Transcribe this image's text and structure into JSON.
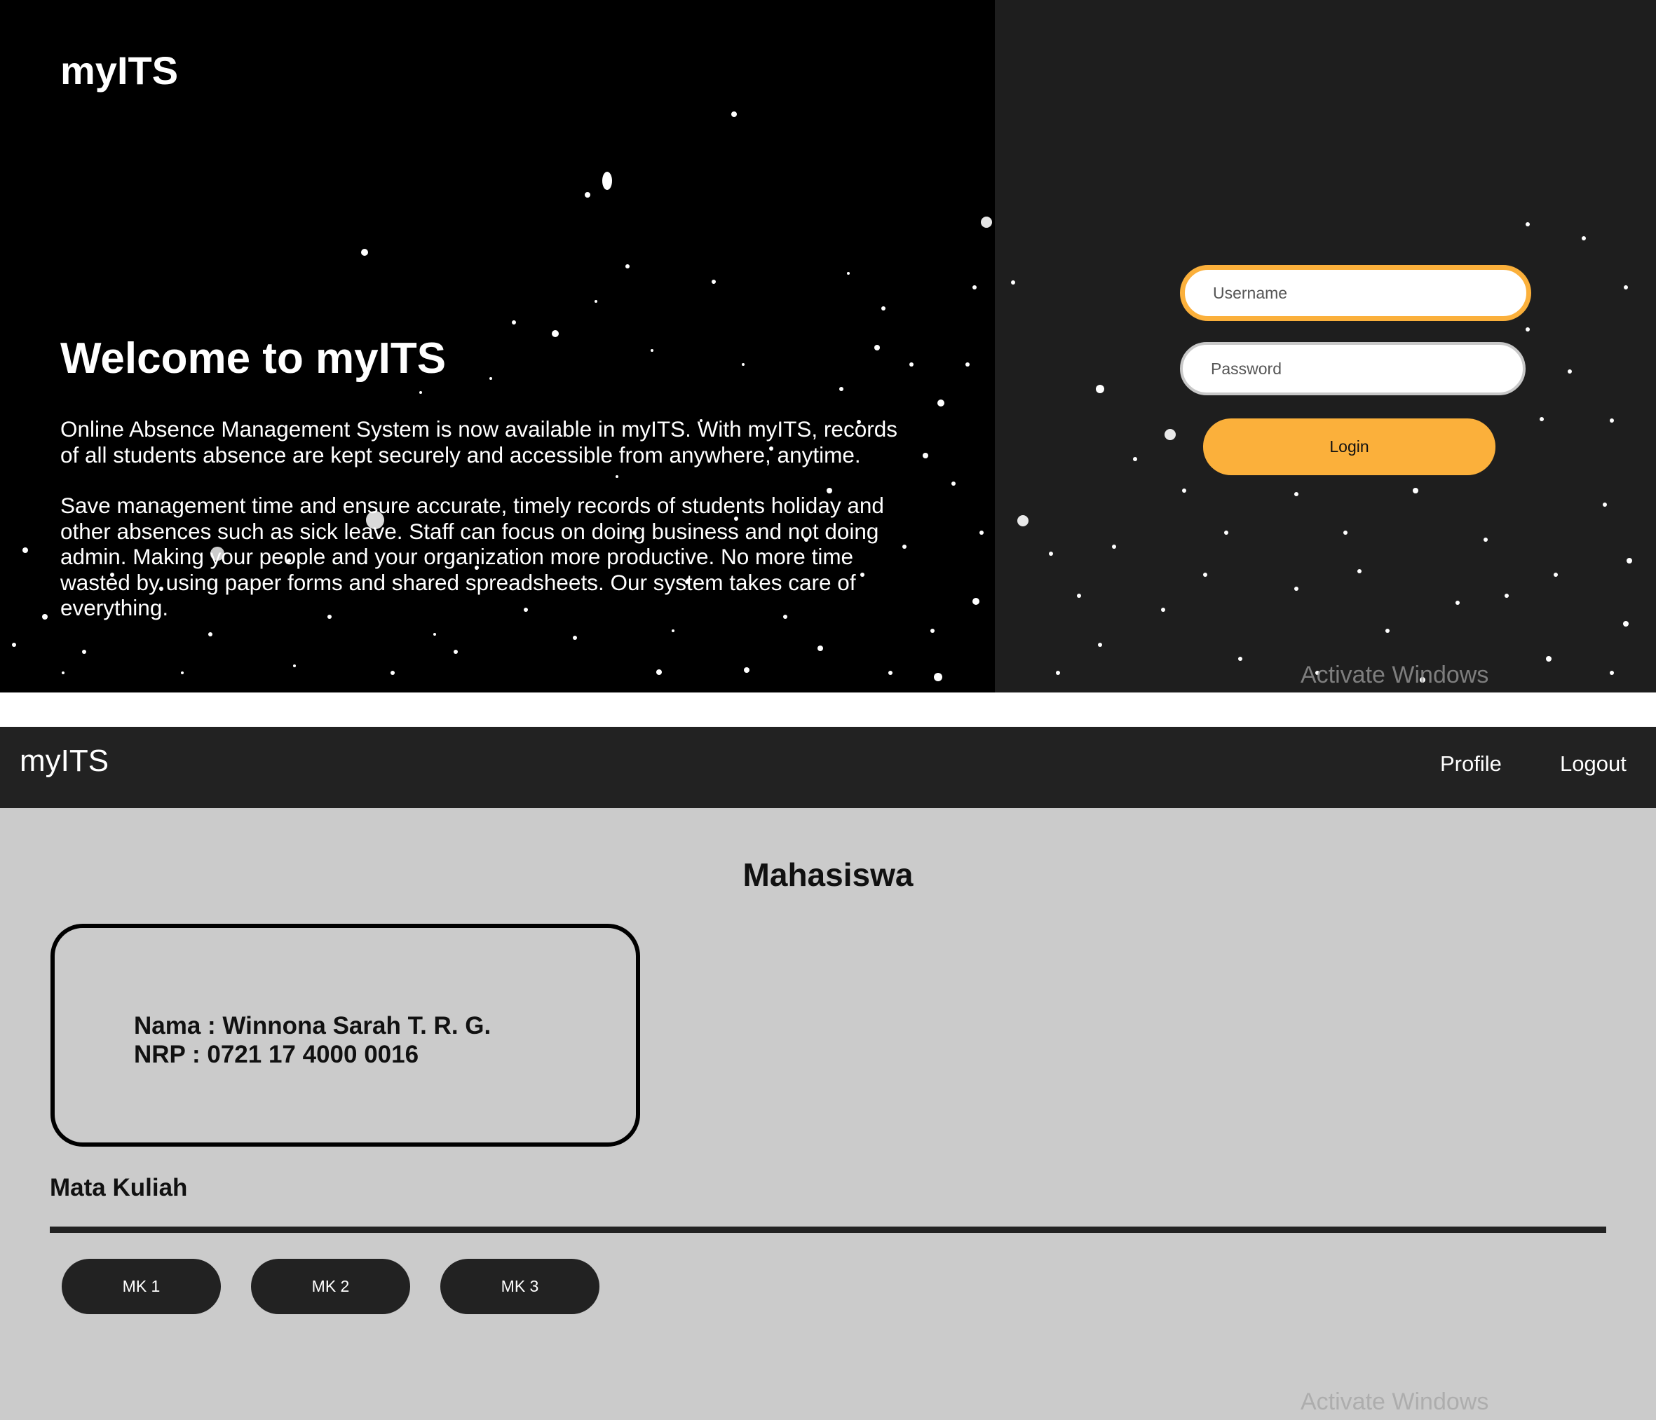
{
  "login_page": {
    "brand": "myITS",
    "welcome_title": "Welcome to myITS",
    "paragraph_1": "Online Absence Management System is now available in myITS. With myITS, records of all students absence are kept securely and accessible from anywhere, anytime.",
    "paragraph_2": "Save management time and ensure accurate, timely records of students holiday and other absences such as sick leave. Staff can focus on doing business and not doing admin. Making your people and your organization more productive. No more time wasted by using paper forms and shared spreadsheets. Our system takes care of everything.",
    "username_placeholder": "Username",
    "password_placeholder": "Password",
    "login_label": "Login",
    "watermark": "Activate Windows"
  },
  "dashboard": {
    "nav": {
      "brand": "myITS",
      "profile": "Profile",
      "logout": "Logout"
    },
    "page_title": "Mahasiswa",
    "student": {
      "name_line": "Nama : Winnona Sarah T. R. G.",
      "nrp_line": "NRP : 0721 17 4000 0016"
    },
    "section_title": "Mata Kuliah",
    "courses": [
      "MK 1",
      "MK 2",
      "MK 3"
    ],
    "watermark": "Activate Windows"
  },
  "colors": {
    "accent": "#fbb03b",
    "dark": "#222222",
    "panel_bg": "#cbcbcb",
    "login_left_bg": "#000000",
    "login_right_bg": "#1e1e1e"
  }
}
